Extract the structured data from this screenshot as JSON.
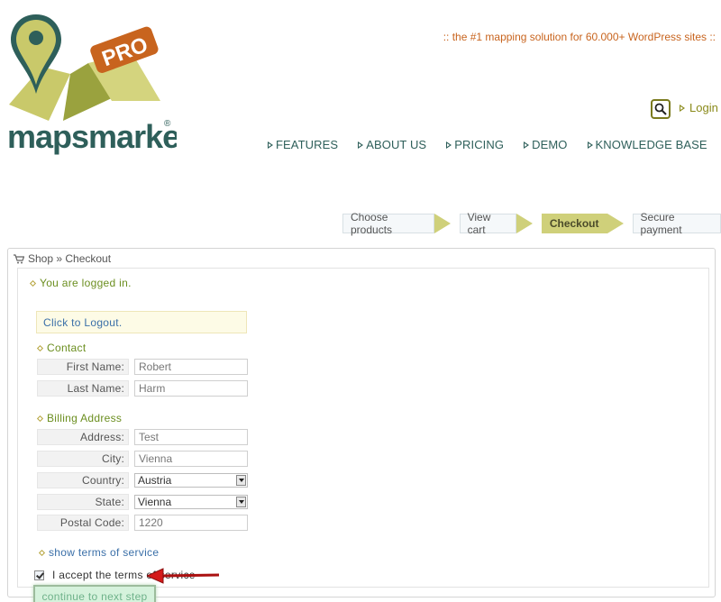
{
  "header": {
    "logo_text": "mapsmarker",
    "logo_badge": "PRO",
    "logo_registered": "®",
    "tagline": ":: the #1 mapping solution for 60.000+ WordPress sites ::",
    "login_label": "Login",
    "search_icon": "search-icon",
    "nav": [
      {
        "label": "FEATURES"
      },
      {
        "label": "ABOUT US"
      },
      {
        "label": "PRICING"
      },
      {
        "label": "DEMO"
      },
      {
        "label": "KNOWLEDGE BASE"
      }
    ],
    "colors": {
      "brand_green": "#2e5f5a",
      "accent_olive": "#cfd07a",
      "accent_orange": "#c8641e"
    }
  },
  "steps": [
    {
      "label": "Choose products",
      "active": false
    },
    {
      "label": "View cart",
      "active": false
    },
    {
      "label": "Checkout",
      "active": true
    },
    {
      "label": "Secure payment",
      "active": false
    }
  ],
  "shop": {
    "breadcrumb": "Shop » Checkout",
    "cart_icon": "cart-icon",
    "logged_in_title": "You are logged in.",
    "logout_link": "Click to Logout.",
    "contact_title": "Contact",
    "billing_title": "Billing Address",
    "fields": {
      "first_name": {
        "label": "First Name:",
        "value": "Robert"
      },
      "last_name": {
        "label": "Last Name:",
        "value": "Harm"
      },
      "address": {
        "label": "Address:",
        "value": "Test"
      },
      "city": {
        "label": "City:",
        "value": "Vienna"
      },
      "country": {
        "label": "Country:",
        "value": "Austria"
      },
      "state": {
        "label": "State:",
        "value": "Vienna"
      },
      "postal_code": {
        "label": "Postal Code:",
        "value": "1220"
      }
    },
    "terms_link": "show terms of service",
    "accept_label": "I accept the terms of service",
    "accept_checked": true,
    "continue_label": "continue to next step"
  }
}
